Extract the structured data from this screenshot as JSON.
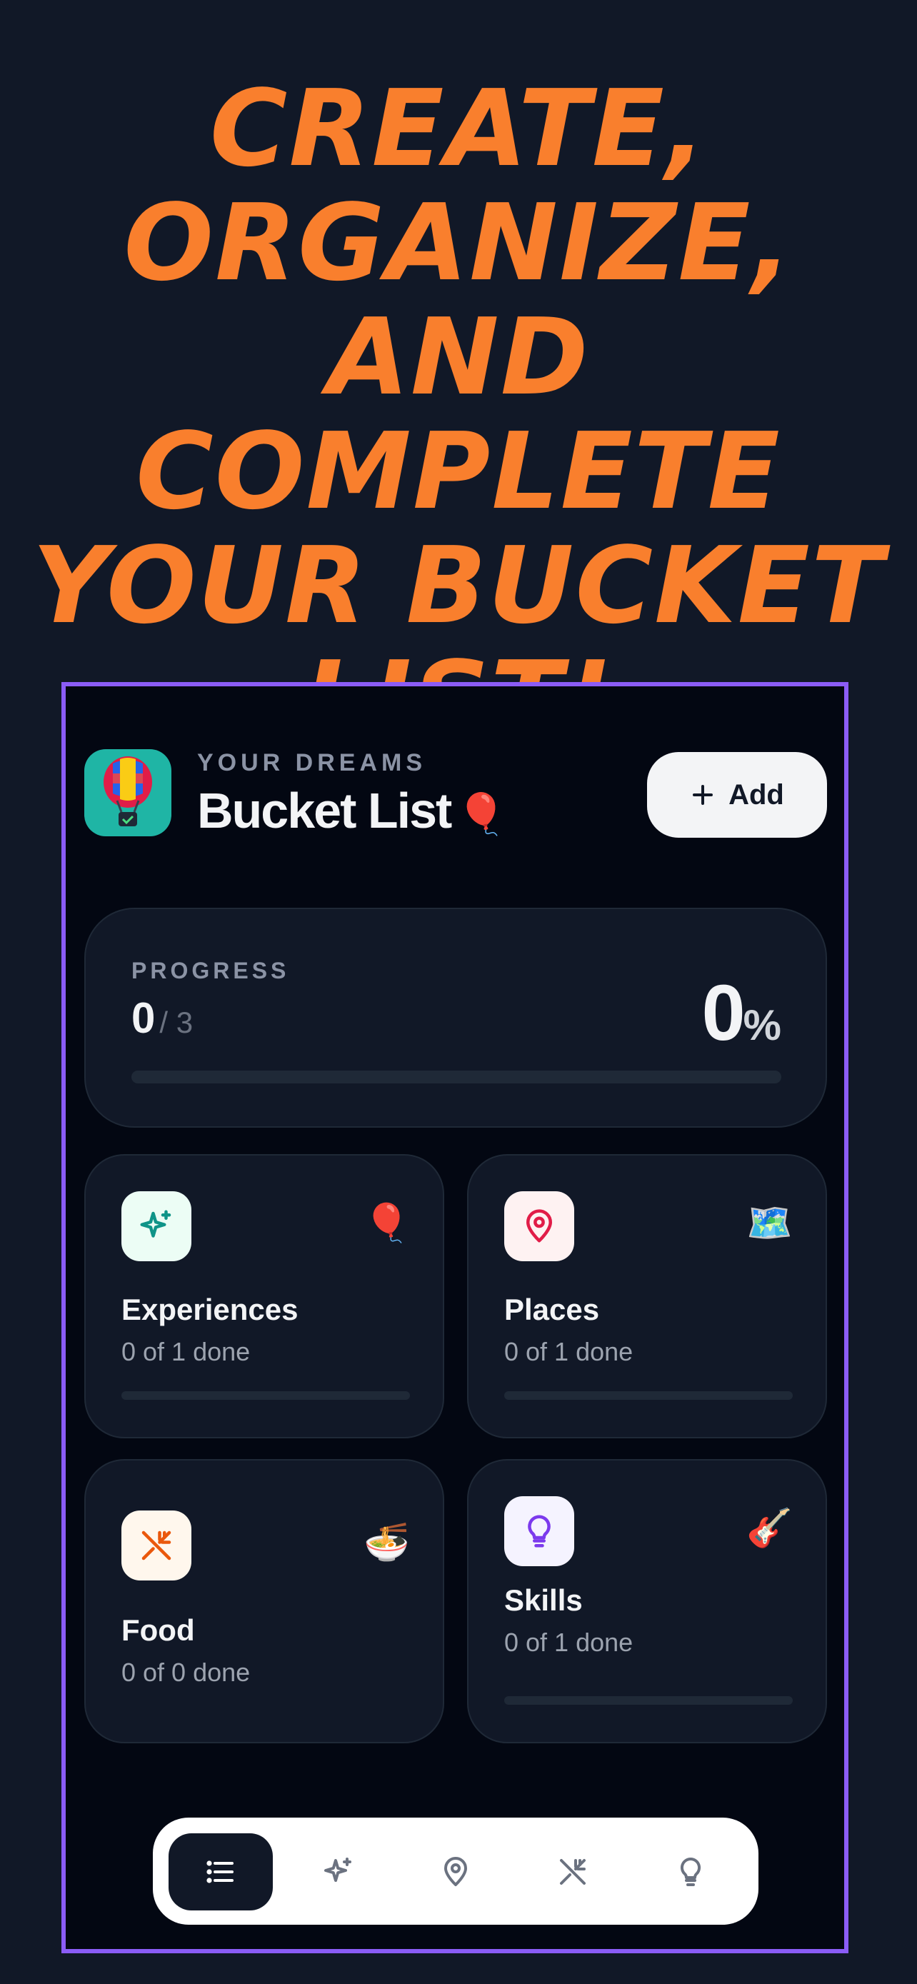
{
  "headline": {
    "lines": [
      "Create,",
      "organize,",
      "and complete",
      "your bucket",
      "list!"
    ]
  },
  "header": {
    "eyebrow": "YOUR DREAMS",
    "title": "Bucket List",
    "title_emoji": "🎈",
    "add_label": "Add",
    "app_icon": "hot-air-balloon-icon"
  },
  "progress": {
    "label": "PROGRESS",
    "done": "0",
    "total": "/ 3",
    "percent": "0",
    "percent_symbol": "%",
    "fraction": 0
  },
  "categories": [
    {
      "name": "Experiences",
      "subtitle": "0 of 1 done",
      "emoji": "🎈",
      "icon": "sparkles-icon",
      "icon_bg": "#ecfdf5",
      "icon_color": "#0f9488",
      "progress": 0
    },
    {
      "name": "Places",
      "subtitle": "0 of 1 done",
      "emoji": "🗺️",
      "icon": "map-pin-icon",
      "icon_bg": "#fef2f2",
      "icon_color": "#e11d48",
      "progress": 0
    },
    {
      "name": "Food",
      "subtitle": "0 of 0 done",
      "emoji": "🍜",
      "icon": "utensils-icon",
      "icon_bg": "#fff7ed",
      "icon_color": "#ea580c",
      "progress": null
    },
    {
      "name": "Skills",
      "subtitle": "0 of 1 done",
      "emoji": "🎸",
      "icon": "lightbulb-icon",
      "icon_bg": "#f5f3ff",
      "icon_color": "#7c3aed",
      "progress": 0
    }
  ],
  "nav": {
    "items": [
      "list-icon",
      "sparkles-icon",
      "map-pin-icon",
      "utensils-icon",
      "lightbulb-icon"
    ],
    "active": 0
  },
  "colors": {
    "background": "#111827",
    "headline": "#f97f2d",
    "frame_border": "#8b5cf6",
    "card": "#111827"
  }
}
